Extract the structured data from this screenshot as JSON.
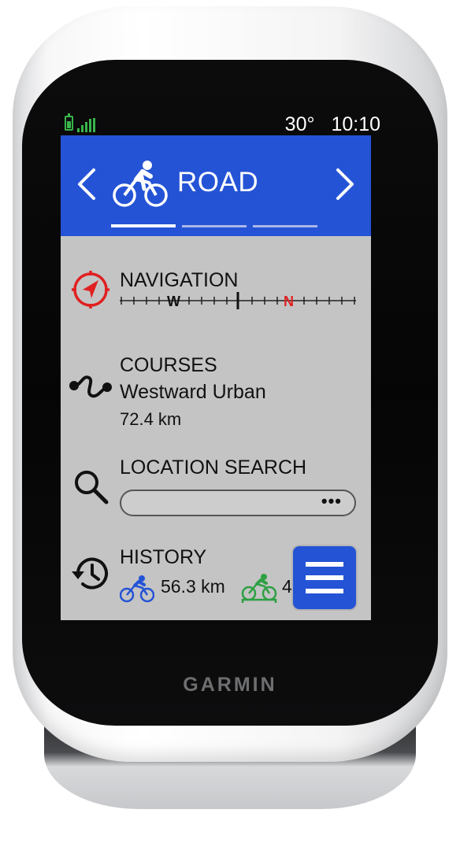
{
  "colors": {
    "header_blue": "#2453d5",
    "screen_gray": "#c4c4c4",
    "battery_green": "#39b54a",
    "nav_red": "#e02020",
    "road_bike_blue": "#2453d5",
    "indoor_bike_green": "#2ea043"
  },
  "status": {
    "battery_icon": "battery-full-icon",
    "signal_icon": "gps-signal-icon",
    "temperature": "30°",
    "time": "10:10"
  },
  "header": {
    "prev_icon": "chevron-left-icon",
    "next_icon": "chevron-right-icon",
    "profile_icon": "road-bike-icon",
    "profile_name": "ROAD",
    "page_count": 3,
    "active_page": 1
  },
  "navigation": {
    "title": "NAVIGATION",
    "icon": "navigation-arrow-icon",
    "compass": {
      "west": "W",
      "north": "N"
    }
  },
  "courses": {
    "title": "COURSES",
    "icon": "course-route-icon",
    "course_name": "Westward Urban",
    "distance": "72.4 km"
  },
  "location_search": {
    "title": "LOCATION SEARCH",
    "icon": "search-icon",
    "placeholder": "",
    "more": "•••"
  },
  "history": {
    "title": "HISTORY",
    "icon": "history-clock-icon",
    "entries": [
      {
        "icon": "road-bike-icon",
        "value": "56.3 km"
      },
      {
        "icon": "indoor-bike-icon",
        "value": "4"
      }
    ]
  },
  "menu": {
    "icon": "menu-icon"
  },
  "brand": "GARMIN"
}
